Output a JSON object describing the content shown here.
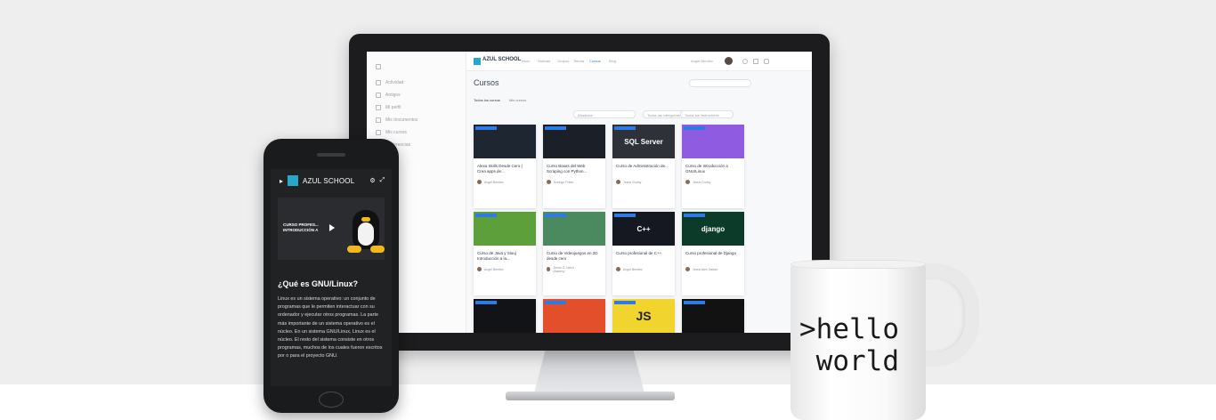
{
  "website": {
    "brand": "AZUL SCHOOL",
    "nav": [
      "Inicio",
      "Noticias",
      "Grupos",
      "Tienda",
      "Cursos",
      "Blog"
    ],
    "user": "Angel Benítez",
    "page_title": "Cursos",
    "search_placeholder": "Buscar cursos",
    "tabs": [
      "Todos los cursos",
      "Mis cursos"
    ],
    "filters": [
      "Añadidos",
      "Todas las categorías",
      "Todos los instructores"
    ],
    "sidebar": [
      "Actividad",
      "Amigos",
      "Mi perfil",
      "Mis documentos",
      "Mis cursos",
      "Preferencias"
    ],
    "courses": [
      {
        "title": "Alexa Skills Desde Cero ( Crea apps de...",
        "author": "Angel Benítez",
        "image_text": "",
        "color": "#1d2631"
      },
      {
        "title": "Curso Bases del Web Scraping con Python...",
        "author": "Rodrigo Prieto",
        "image_text": "",
        "color": "#1b1f28"
      },
      {
        "title": "Curso de Administración de...",
        "author": "Jesús Godoy",
        "image_text": "SQL Server",
        "color": "#2e3137"
      },
      {
        "title": "Curso de Introducción a GNU/Linux",
        "author": "Jesús Godoy",
        "image_text": "",
        "color": "#8f5be0"
      },
      {
        "title": "Curso de Java y Sluuj Introducción a la...",
        "author": "Angel Benítez",
        "image_text": "",
        "color": "#5d9f3b"
      },
      {
        "title": "Curso de Videojuegos en 2D desde cero",
        "author": "Jesús G. Neira (Bakery)",
        "image_text": "",
        "color": "#4a8a5e"
      },
      {
        "title": "Curso profesional de C++.",
        "author": "Angel Benítez",
        "image_text": "C++",
        "color": "#151820"
      },
      {
        "title": "Curso profesional de Django",
        "author": "Jesús Alex Gaitan",
        "image_text": "django",
        "color": "#0c3b2a"
      },
      {
        "title": "",
        "author": "",
        "image_text": "",
        "color": "#111316"
      },
      {
        "title": "",
        "author": "",
        "image_text": "",
        "color": "#e24f2a"
      },
      {
        "title": "",
        "author": "",
        "image_text": "JS",
        "color": "#f2d42f"
      },
      {
        "title": "",
        "author": "",
        "image_text": "",
        "color": "#121212"
      }
    ]
  },
  "phone": {
    "brand": "AZUL SCHOOL",
    "video_text": "CURSO PROFES... INTRODUCCIÓN A",
    "heading": "¿Qué es GNU/Linux?",
    "body": "Linux es un sistema operativo: un conjunto de programas que le permiten interactuar con su ordenador y ejecutar otros programas. La parte más importante de un sistema operativo es el núcleo. En un sistema GNU/Linux, Linux es el núcleo. El resto del sistema consiste en otros programas, muchos de los cuales fueron escritos por o para el proyecto GNU."
  },
  "mug": {
    "line1": ">hello",
    "line2": " world"
  },
  "colors": {
    "brand_accent": "#26a9c8",
    "badge": "#2f7ae5"
  }
}
